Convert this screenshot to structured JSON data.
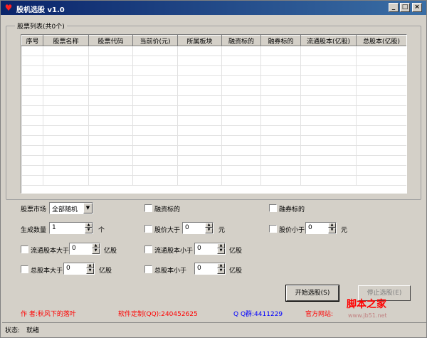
{
  "window": {
    "title": "股机选股 v1.0",
    "buttons": {
      "minimize": "_",
      "maximize": "□",
      "close": "×"
    }
  },
  "stock_list": {
    "group_title": "股票列表(共0个)",
    "columns": [
      "序号",
      "股票名称",
      "股票代码",
      "当前价(元)",
      "所属板块",
      "融资标的",
      "融券标的",
      "流通股本(亿股)",
      "总股本(亿股)"
    ]
  },
  "options": {
    "market_label": "股票市场",
    "market_value": "全部随机",
    "count_label": "生成数量",
    "count_value": "1",
    "count_unit": "个",
    "financing_label": "融资标的",
    "short_label": "融券标的",
    "price_gt_label": "股价大于",
    "price_gt_value": "0",
    "price_gt_unit": "元",
    "price_lt_label": "股价小于",
    "price_lt_value": "0",
    "price_lt_unit": "元",
    "float_gt_label": "流通股本大于",
    "float_gt_value": "0",
    "float_gt_unit": "亿股",
    "float_lt_label": "流通股本小于",
    "float_lt_value": "0",
    "float_lt_unit": "亿股",
    "total_gt_label": "总股本大于",
    "total_gt_value": "0",
    "total_gt_unit": "亿股",
    "total_lt_label": "总股本小于",
    "total_lt_value": "0",
    "total_lt_unit": "亿股"
  },
  "actions": {
    "start": "开始选股(S)",
    "stop": "停止选股(E)"
  },
  "footer": {
    "author": "作 者:秋风下的落叶",
    "custom": "软件定制(QQ):240452625",
    "qq_group": "Q Q群:4411229",
    "website": "官方网站:"
  },
  "status": {
    "label": "状态:",
    "value": "就绪"
  },
  "watermark": {
    "main": "脚本之家",
    "sub": "www.jb51.net"
  }
}
